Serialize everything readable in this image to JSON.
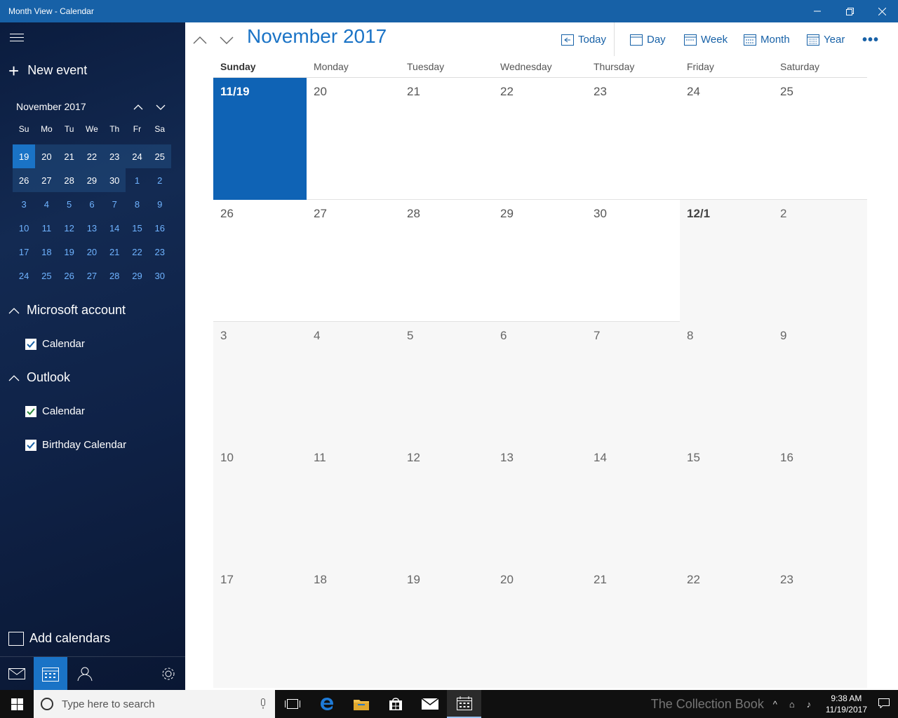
{
  "window": {
    "title": "Month View - Calendar",
    "minimize": "—",
    "maximize": "❐",
    "close": "✕"
  },
  "sidebar": {
    "new_event": "New event",
    "mini_month": "November 2017",
    "dow": [
      "Su",
      "Mo",
      "Tu",
      "We",
      "Th",
      "Fr",
      "Sa"
    ],
    "weeks": [
      [
        "19",
        "20",
        "21",
        "22",
        "23",
        "24",
        "25"
      ],
      [
        "26",
        "27",
        "28",
        "29",
        "30",
        "1",
        "2"
      ],
      [
        "3",
        "4",
        "5",
        "6",
        "7",
        "8",
        "9"
      ],
      [
        "10",
        "11",
        "12",
        "13",
        "14",
        "15",
        "16"
      ],
      [
        "17",
        "18",
        "19",
        "20",
        "21",
        "22",
        "23"
      ],
      [
        "24",
        "25",
        "26",
        "27",
        "28",
        "29",
        "30"
      ]
    ],
    "accounts": [
      {
        "name": "Microsoft account",
        "calendars": [
          "Calendar"
        ]
      },
      {
        "name": "Outlook",
        "calendars": [
          "Calendar",
          "Birthday Calendar"
        ]
      }
    ],
    "add_calendars": "Add calendars"
  },
  "toolbar": {
    "month_title": "November 2017",
    "today": "Today",
    "day": "Day",
    "week": "Week",
    "month": "Month",
    "year": "Year",
    "more": "•••"
  },
  "calendar": {
    "days_of_week": [
      "Sunday",
      "Monday",
      "Tuesday",
      "Wednesday",
      "Thursday",
      "Friday",
      "Saturday"
    ],
    "weeks": [
      [
        "11/19",
        "20",
        "21",
        "22",
        "23",
        "24",
        "25"
      ],
      [
        "26",
        "27",
        "28",
        "29",
        "30",
        "12/1",
        "2"
      ],
      [
        "3",
        "4",
        "5",
        "6",
        "7",
        "8",
        "9"
      ],
      [
        "10",
        "11",
        "12",
        "13",
        "14",
        "15",
        "16"
      ],
      [
        "17",
        "18",
        "19",
        "20",
        "21",
        "22",
        "23"
      ]
    ]
  },
  "taskbar": {
    "search_placeholder": "Type here to search",
    "time": "9:38 AM",
    "date": "11/19/2017",
    "watermark": "The Collection Book"
  }
}
